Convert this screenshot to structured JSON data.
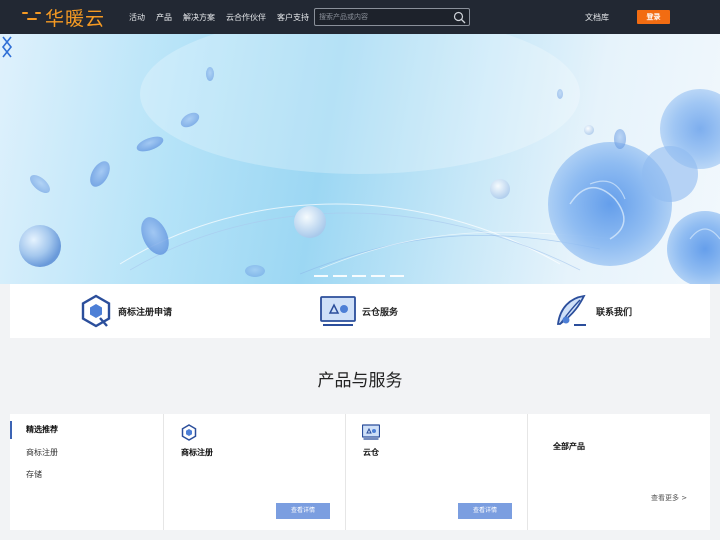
{
  "header": {
    "logo_text": "华暖云",
    "nav": [
      "活动",
      "产品",
      "解决方案",
      "云合作伙伴",
      "客户支持"
    ],
    "search_placeholder": "搜索产品或内容",
    "docs_label": "文档库",
    "login_label": "登录"
  },
  "banner": {
    "slide_count": 5
  },
  "features": [
    {
      "label": "商标注册申请",
      "icon": "trademark-icon"
    },
    {
      "label": "云仓服务",
      "icon": "cloud-warehouse-icon"
    },
    {
      "label": "联系我们",
      "icon": "quill-icon"
    }
  ],
  "section": {
    "title": "产品与服务"
  },
  "products": {
    "tabs": [
      {
        "label": "精选推荐",
        "active": true
      },
      {
        "label": "商标注册",
        "active": false
      },
      {
        "label": "存储",
        "active": false
      }
    ],
    "cards": [
      {
        "title": "商标注册",
        "button": "查看详情",
        "icon": "trademark-icon"
      },
      {
        "title": "云仓",
        "button": "查看详情",
        "icon": "cloud-warehouse-icon"
      }
    ],
    "all_products": {
      "title": "全部产品",
      "more_label": "查看更多 >"
    }
  },
  "colors": {
    "nav_bg": "#222833",
    "brand": "#f59a23",
    "login_bg": "#f26c12",
    "button_blue": "#7b9ee0",
    "page_bg": "#f2f3f5"
  }
}
